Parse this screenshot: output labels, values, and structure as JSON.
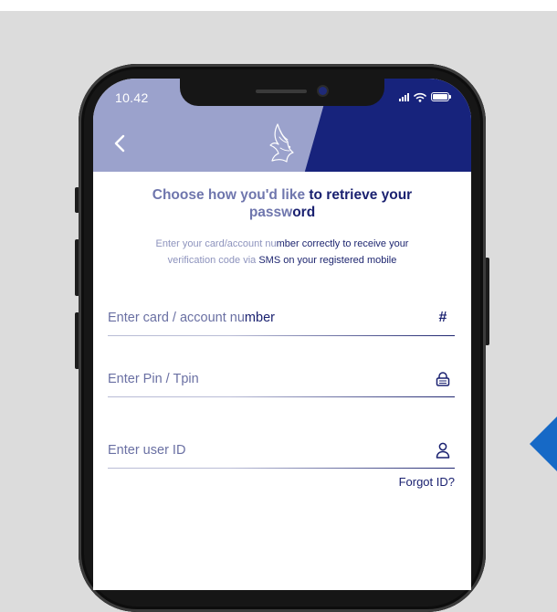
{
  "status_bar": {
    "time": "10.42"
  },
  "header": {
    "back_icon": "chevron-left-icon",
    "logo_icon": "eagle-logo-icon",
    "colors": {
      "light": "#9ba2cc",
      "dark": "#17237c"
    }
  },
  "page": {
    "title_light": "Choose how you'd like ",
    "title_dark": "to retrieve your",
    "title_light2": "passw",
    "title_dark2": "ord",
    "subtitle_light": "Enter your card/account nu",
    "subtitle_dark": "mber correctly to receive your",
    "subtitle_light2": "verification code via ",
    "subtitle_dark2": "SMS on your registered mobile"
  },
  "form": {
    "card_label_light": "Enter card / account nu",
    "card_label_dark": "mber",
    "card_icon_text": "#",
    "pin_label": "Enter Pin / Tpin",
    "user_id_label": "Enter user ID",
    "forgot_id": "Forgot ID?"
  },
  "colors": {
    "accent": "#1669c6",
    "navy": "#1a2170",
    "background": "#dcdcdc"
  }
}
